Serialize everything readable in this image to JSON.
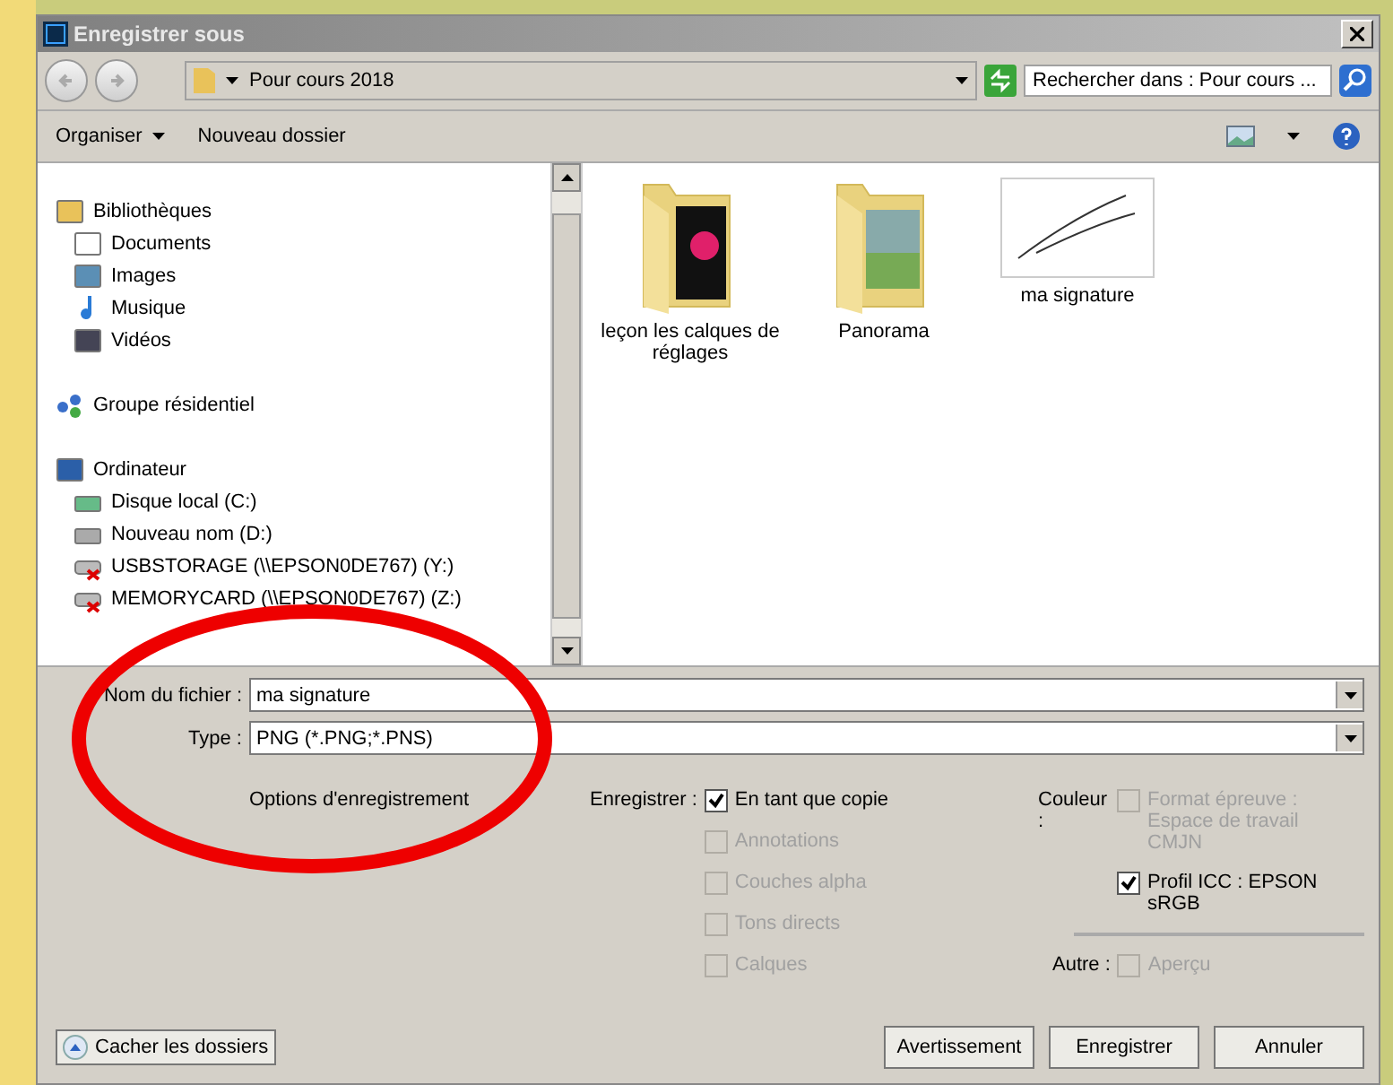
{
  "window": {
    "title": "Enregistrer sous"
  },
  "address": {
    "path": "Pour cours 2018",
    "search_placeholder": "Rechercher dans : Pour cours ..."
  },
  "toolbar": {
    "items": [
      "Organiser",
      "Nouveau dossier"
    ]
  },
  "sidebar": {
    "items": [
      {
        "label": "Bibliothèques",
        "kind": "library",
        "children": [
          {
            "label": "Documents",
            "kind": "document"
          },
          {
            "label": "Images",
            "kind": "picture"
          },
          {
            "label": "Musique",
            "kind": "music"
          },
          {
            "label": "Vidéos",
            "kind": "video"
          }
        ]
      },
      {
        "label": "Groupe résidentiel",
        "kind": "homegroup"
      },
      {
        "label": "Ordinateur",
        "kind": "computer",
        "children": [
          {
            "label": "Disque local (C:)",
            "kind": "system-drive"
          },
          {
            "label": "Nouveau nom (D:)",
            "kind": "drive"
          },
          {
            "label": "USBSTORAGE (\\\\EPSON0DE767) (Y:)",
            "kind": "net-drive"
          },
          {
            "label": "MEMORYCARD (\\\\EPSON0DE767) (Z:)",
            "kind": "net-drive"
          }
        ]
      }
    ]
  },
  "files": [
    {
      "label": "leçon les calques de réglages",
      "kind": "folder-flower"
    },
    {
      "label": "Panorama",
      "kind": "folder-landscape"
    },
    {
      "label": "ma signature",
      "kind": "signature"
    }
  ],
  "form": {
    "filename_label": "Nom du fichier :",
    "filename": "ma signature",
    "type_label": "Type :",
    "type": "PNG (*.PNG;*.PNS)"
  },
  "options": {
    "title": "Options d'enregistrement",
    "save_label": "Enregistrer :",
    "save": [
      {
        "label": "En tant que copie",
        "checked": true,
        "disabled": false
      },
      {
        "label": "Annotations",
        "checked": false,
        "disabled": true
      },
      {
        "label": "Couches alpha",
        "checked": false,
        "disabled": true
      },
      {
        "label": "Tons directs",
        "checked": false,
        "disabled": true
      },
      {
        "label": "Calques",
        "checked": false,
        "disabled": true
      }
    ],
    "color_label": "Couleur :",
    "color": [
      {
        "label": "Format épreuve : Espace de travail CMJN",
        "checked": false,
        "disabled": true
      },
      {
        "label": "Profil ICC : EPSON sRGB",
        "checked": true,
        "disabled": false
      }
    ],
    "other_label": "Autre :",
    "other": [
      {
        "label": "Aperçu",
        "checked": false,
        "disabled": true
      }
    ]
  },
  "hide_folders": "Cacher les dossiers",
  "buttons": [
    "Avertissement",
    "Enregistrer",
    "Annuler"
  ]
}
